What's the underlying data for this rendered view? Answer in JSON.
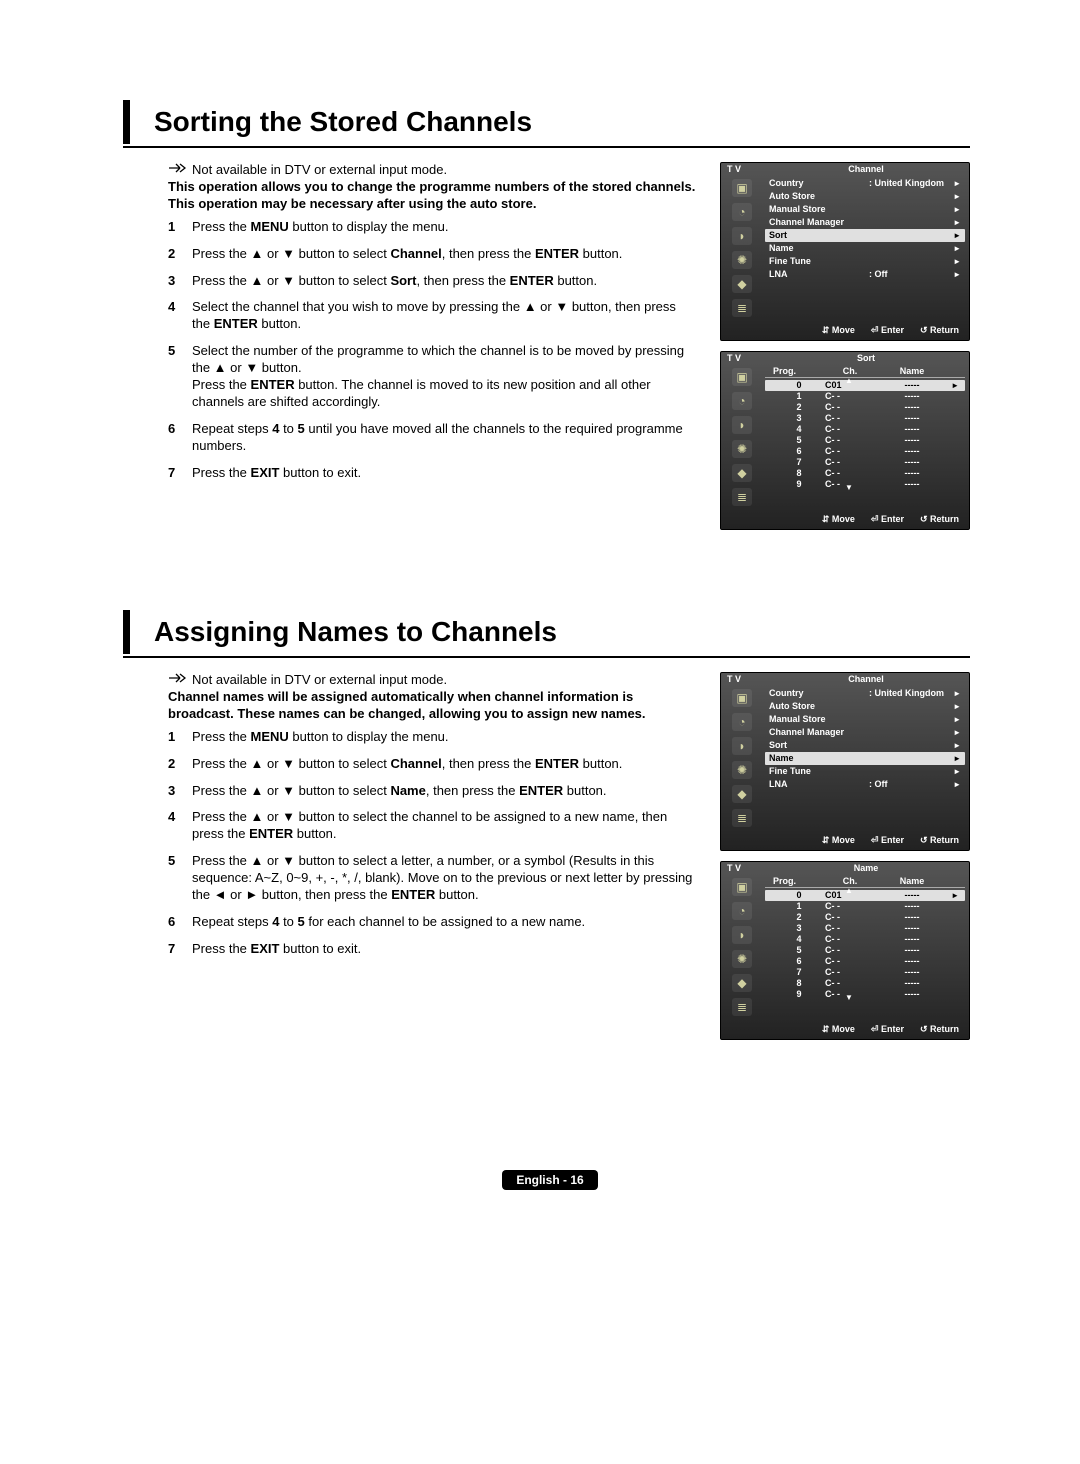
{
  "sections": [
    {
      "title": "Sorting the Stored Channels",
      "note": "Not available in DTV or external input mode.",
      "intro": "This operation allows you to change the programme numbers of the stored channels.\nThis operation may be necessary after using the auto store.",
      "steps": [
        "Press the <b>MENU</b> button to display the menu.",
        "Press the ▲ or ▼ button to select <b>Channel</b>, then press the <b>ENTER</b> button.",
        "Press the ▲ or ▼ button to select <b>Sort</b>, then press the <b>ENTER</b> button.",
        "Select the channel that you wish to move by pressing the ▲ or ▼ button, then press the <b>ENTER</b> button.",
        "Select the number of the programme to which the channel is to be moved by pressing the ▲ or ▼ button.\nPress the <b>ENTER</b> button. The channel is moved to its new position and all other channels are shifted accordingly.",
        "Repeat steps <b>4</b> to <b>5</b> until you have moved all the channels to the required programme numbers.",
        "Press the <b>EXIT</b> button to exit."
      ],
      "osd_channel_highlight": "Sort",
      "osd_table_title": "Sort"
    },
    {
      "title": "Assigning Names to Channels",
      "note": "Not available in DTV or external input mode.",
      "intro": "Channel names will be assigned automatically when channel information is broadcast. These names can be changed, allowing you to assign new names.",
      "steps": [
        "Press the <b>MENU</b> button to display the menu.",
        "Press the ▲ or ▼ button to select <b>Channel</b>, then press the <b>ENTER</b> button.",
        "Press the ▲ or ▼ button to select <b>Name</b>, then press the <b>ENTER</b> button.",
        "Press the ▲ or ▼ button to select the channel to be assigned to a new name, then press the <b>ENTER</b> button.",
        "Press the ▲ or ▼ button to select a letter, a number, or a symbol (Results in this sequence: A~Z, 0~9, +, -, *, /, blank). Move on to the previous or next letter by pressing the ◄ or ► button, then press the <b>ENTER</b> button.",
        "Repeat steps <b>4</b> to <b>5</b> for each channel to be assigned to a new name.",
        "Press the <b>EXIT</b> button to exit."
      ],
      "osd_channel_highlight": "Name",
      "osd_table_title": "Name"
    }
  ],
  "osd": {
    "tv_label": "T V",
    "channel_menu_title": "Channel",
    "items": [
      {
        "label": "Country",
        "value": ": United Kingdom",
        "arrow": "►"
      },
      {
        "label": "Auto Store",
        "value": "",
        "arrow": "►"
      },
      {
        "label": "Manual Store",
        "value": "",
        "arrow": "►"
      },
      {
        "label": "Channel Manager",
        "value": "",
        "arrow": "►"
      },
      {
        "label": "Sort",
        "value": "",
        "arrow": "►"
      },
      {
        "label": "Name",
        "value": "",
        "arrow": "►"
      },
      {
        "label": "Fine Tune",
        "value": "",
        "arrow": "►"
      },
      {
        "label": "LNA",
        "value": ": Off",
        "arrow": "►"
      }
    ],
    "table_headers": {
      "prog": "Prog.",
      "ch": "Ch.",
      "name": "Name"
    },
    "table_rows": [
      {
        "prog": "0",
        "ch": "C01",
        "name": "-----",
        "selected": true
      },
      {
        "prog": "1",
        "ch": "C- -",
        "name": "-----"
      },
      {
        "prog": "2",
        "ch": "C- -",
        "name": "-----"
      },
      {
        "prog": "3",
        "ch": "C- -",
        "name": "-----"
      },
      {
        "prog": "4",
        "ch": "C- -",
        "name": "-----"
      },
      {
        "prog": "5",
        "ch": "C- -",
        "name": "-----"
      },
      {
        "prog": "6",
        "ch": "C- -",
        "name": "-----"
      },
      {
        "prog": "7",
        "ch": "C- -",
        "name": "-----"
      },
      {
        "prog": "8",
        "ch": "C- -",
        "name": "-----"
      },
      {
        "prog": "9",
        "ch": "C- -",
        "name": "-----"
      }
    ],
    "footer": {
      "move": "Move",
      "enter": "Enter",
      "return": "Return"
    }
  },
  "footer": {
    "label": "English - 16"
  }
}
